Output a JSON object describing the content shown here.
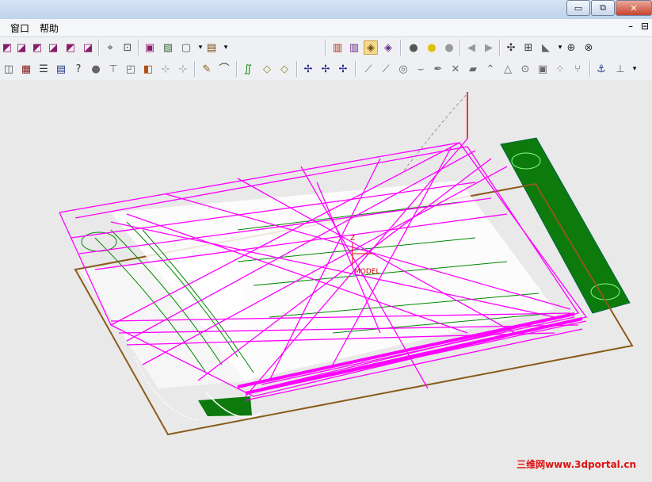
{
  "menu": {
    "window": "窗口",
    "help": "帮助"
  },
  "window_controls": {
    "minimize": "▭",
    "restore": "⧉",
    "close": "✕",
    "mdi_restore": "⊟"
  },
  "toolbar1": {
    "groups": [
      [
        "cube-iso",
        "cube-front",
        "cube-back",
        "cube-left",
        "cube-right",
        "cube-top"
      ],
      [
        "view-fit",
        "view-zoom"
      ],
      [
        "shaded-box",
        "wireframe-box",
        "box-dropdown",
        "render-dropdown"
      ],
      [
        "block-a",
        "block-b",
        "block-c",
        "block-d"
      ],
      [
        "bulb-off",
        "bulb-on",
        "bulb-group"
      ],
      [
        "arrow-left",
        "arrow-right"
      ],
      [
        "tool-a",
        "tool-b",
        "tool-c",
        "tool-d",
        "tool-e"
      ]
    ]
  },
  "toolbar2": {
    "icons": [
      "open",
      "props",
      "list",
      "layers",
      "help",
      "sphere",
      "tool",
      "cube-small",
      "stack",
      "grid-a",
      "grid-b",
      "sketch",
      "curve",
      "surface",
      "solid-a",
      "solid-b",
      "axis-a",
      "axis-b",
      "axis-c",
      "line",
      "line2",
      "circle",
      "arc",
      "pen",
      "cross",
      "hatch",
      "vertex",
      "triangle",
      "point",
      "box",
      "dots",
      "branch",
      "anchor",
      "dim"
    ]
  },
  "viewport": {
    "axis_label_z": "Z",
    "model_label": "MODEL",
    "colors": {
      "toolpath": "#ff00ff",
      "geometry": "#008800",
      "boundary": "#8b5a1a",
      "fixture": "#0c7a0c"
    }
  },
  "watermark": "三维网www.3dportal.cn"
}
